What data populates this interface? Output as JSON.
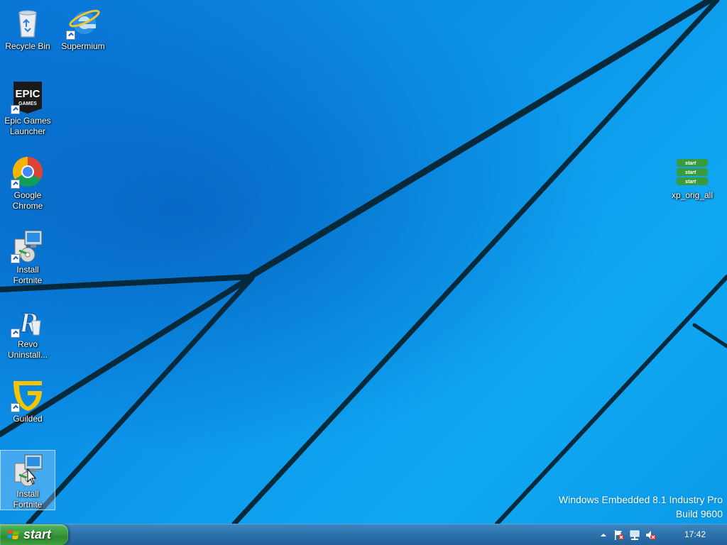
{
  "desktop": {
    "icons": [
      {
        "id": "recycle-bin",
        "label": "Recycle Bin"
      },
      {
        "id": "supermium",
        "label": "Supermium"
      },
      {
        "id": "epic-games",
        "label": "Epic Games\nLauncher",
        "logo_top": "EPIC",
        "logo_bottom": "GAMES"
      },
      {
        "id": "google-chrome",
        "label": "Google\nChrome"
      },
      {
        "id": "install-fortnite-1",
        "label": "Install\nFortnite"
      },
      {
        "id": "revo",
        "label": "Revo\nUninstall..."
      },
      {
        "id": "guilded",
        "label": "Guilded"
      },
      {
        "id": "install-fortnite-2",
        "label": "Install\nFortnite"
      },
      {
        "id": "xp-orig-all",
        "label": "xp_orig_all",
        "thumb_text": "start"
      }
    ]
  },
  "version": {
    "line1": "Windows Embedded 8.1 Industry Pro",
    "line2": "Build 9600"
  },
  "taskbar": {
    "start_label": "start",
    "clock": "17:42",
    "tray_icons": [
      "show-hidden-icons-icon",
      "action-center-flag-icon",
      "network-icon",
      "volume-muted-icon"
    ]
  },
  "colors": {
    "wallpaper_blue": "#0b8fe6",
    "taskbar_blue": "#2b71ab",
    "start_green": "#3a9b3c"
  }
}
